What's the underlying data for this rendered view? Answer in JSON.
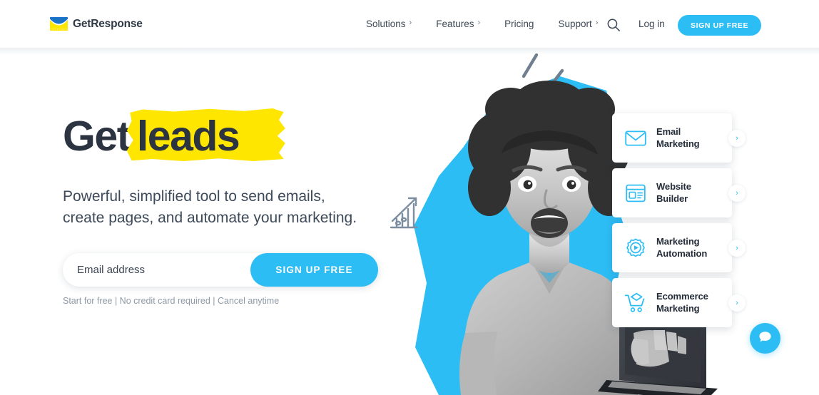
{
  "header": {
    "logo": {
      "icon": "envelope-logo-icon",
      "text": "GetResponse",
      "envelope_body_color": "#ffe600",
      "envelope_flap_color": "#1a73c7"
    },
    "nav": [
      {
        "label": "Solutions",
        "caret": "›",
        "has_caret": true
      },
      {
        "label": "Features",
        "caret": "›",
        "has_caret": true
      },
      {
        "label": "Pricing",
        "caret": "",
        "has_caret": false
      },
      {
        "label": "Support",
        "caret": "›",
        "has_caret": true
      }
    ],
    "search_icon": "search-icon",
    "login_label": "Log in",
    "signup_label": "SIGN UP FREE"
  },
  "hero": {
    "headline_prefix": "Get",
    "headline_highlight": "leads",
    "subheadline_line1": "Powerful, simplified tool to send emails,",
    "subheadline_line2": "create pages, and automate your marketing.",
    "email_placeholder": "Email address",
    "email_value": "",
    "cta_label": "SIGN UP FREE",
    "disclaimer": "Start for free | No credit card required | Cancel anytime"
  },
  "cards": [
    {
      "line1": "Email",
      "line2": "Marketing",
      "icon": "envelope-icon",
      "arrow": "›"
    },
    {
      "line1": "Website",
      "line2": "Builder",
      "icon": "browser-layout-icon",
      "arrow": "›"
    },
    {
      "line1": "Marketing",
      "line2": "Automation",
      "icon": "gear-play-icon",
      "arrow": "›"
    },
    {
      "line1": "Ecommerce",
      "line2": "Marketing",
      "icon": "shopping-cart-icon",
      "arrow": "›"
    }
  ],
  "chat": {
    "icon": "chat-bubble-icon",
    "label": ""
  },
  "colors": {
    "brand_blue": "#2dbdf5",
    "brand_yellow": "#ffe600",
    "text_dark": "#2b3440",
    "text_muted": "#8d99a6",
    "photo_blue_shape": "#2dbdf5"
  }
}
